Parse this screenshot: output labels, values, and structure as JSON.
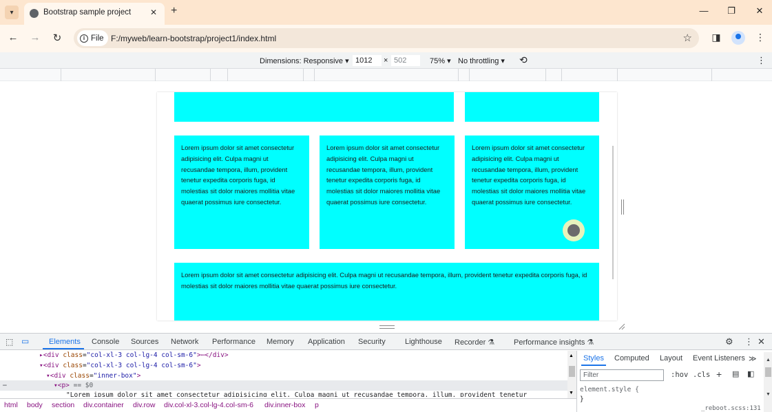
{
  "browser": {
    "tab_title": "Bootstrap sample project",
    "new_tab_label": "+",
    "tab_close_label": "✕",
    "window_controls": {
      "minimize": "—",
      "restore": "❐",
      "close": "✕"
    },
    "file_label": "File",
    "url": "F:/myweb/learn-bootstrap/project1/index.html"
  },
  "device_toolbar": {
    "dimensions_label": "Dimensions: Responsive ▾",
    "width": "1012",
    "times": "×",
    "height": "502",
    "zoom": "75% ▾",
    "throttling": "No throttling ▾"
  },
  "page": {
    "lorem_short": "Lorem ipsum dolor sit amet consectetur adipisicing elit. Culpa magni ut recusandae tempora, illum, provident tenetur expedita corporis fuga, id molestias sit dolor maiores mollitia vitae quaerat possimus iure consectetur.",
    "lorem_wide": "Lorem ipsum dolor sit amet consectetur adipisicing elit. Culpa magni ut recusandae tempora, illum, provident tenetur expedita corporis fuga, id molestias sit dolor maiores mollitia vitae quaerat possimus iure consectetur."
  },
  "devtools": {
    "tabs": [
      "Elements",
      "Console",
      "Sources",
      "Network",
      "Performance",
      "Memory",
      "Application",
      "Security",
      "Lighthouse",
      "Recorder ⚗",
      "Performance insights ⚗"
    ],
    "elements": {
      "line1_tag": "▸<div ",
      "line1_attr": "class",
      "line1_val": "\"col-xl-3 col-lg-4 col-sm-6\"",
      "line1_rest": ">⋯</div>",
      "line2_tag": "▾<div ",
      "line2_attr": "class",
      "line2_val": "\"col-xl-3 col-lg-4 col-sm-6\"",
      "line2_rest": ">",
      "line3_tag": "▾<div ",
      "line3_attr": "class",
      "line3_val": "\"inner-box\"",
      "line3_rest": ">",
      "line4_tag": "▾<p>",
      "line4_rest": " == $0",
      "line5": "\"Lorem ipsum dolor sit amet consectetur adipisicing elit. Culpa magni ut recusandae tempora, illum, provident tenetur",
      "dots": "⋯"
    },
    "breadcrumbs": [
      "html",
      "body",
      "section",
      "div.container",
      "div.row",
      "div.col-xl-3.col-lg-4.col-sm-6",
      "div.inner-box",
      "p"
    ],
    "styles": {
      "tabs": [
        "Styles",
        "Computed",
        "Layout",
        "Event Listeners",
        "≫"
      ],
      "filter_placeholder": "Filter",
      "hov": ":hov",
      "cls": ".cls",
      "element_style": "element.style {",
      "element_style_close": "}",
      "source_link": "_reboot.scss:131"
    }
  }
}
